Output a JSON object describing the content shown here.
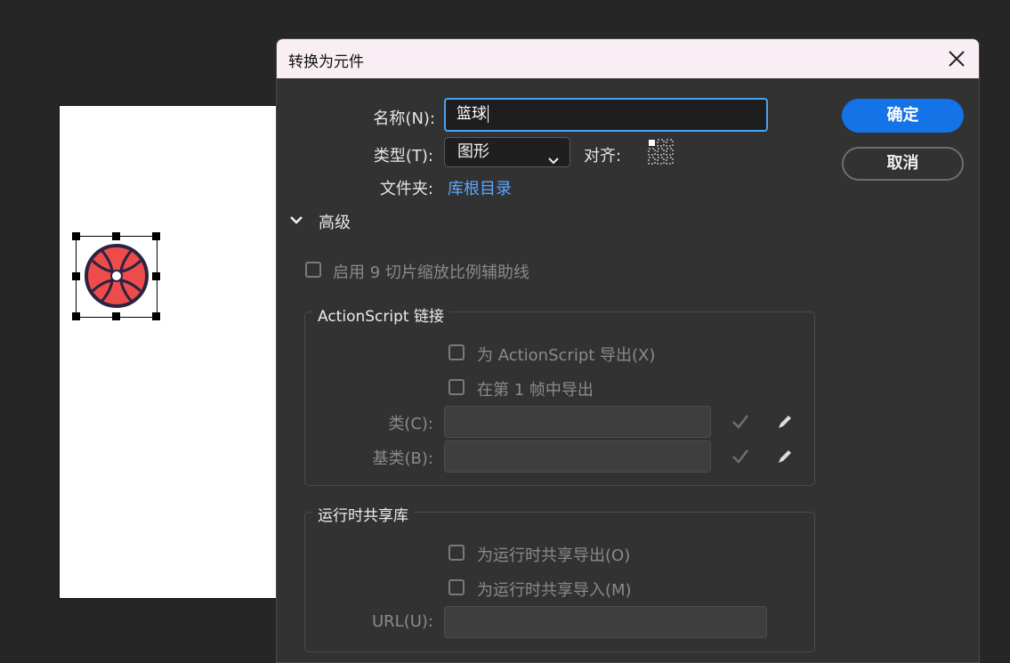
{
  "dialog": {
    "title": "转换为元件",
    "name_label": "名称(N):",
    "name_value": "篮球",
    "type_label": "类型(T):",
    "type_value": "图形",
    "align_label": "对齐:",
    "folder_label": "文件夹:",
    "folder_link": "库根目录",
    "advanced_label": "高级",
    "ok_label": "确定",
    "cancel_label": "取消",
    "nine_slice_label": "启用 9 切片缩放比例辅助线",
    "actionscript": {
      "legend": "ActionScript 链接",
      "export_as_label": "为 ActionScript 导出(X)",
      "export_frame1_label": "在第 1 帧中导出",
      "class_label": "类(C):",
      "base_class_label": "基类(B):"
    },
    "runtime": {
      "legend": "运行时共享库",
      "export_label": "为运行时共享导出(O)",
      "import_label": "为运行时共享导入(M)",
      "url_label": "URL(U):"
    }
  },
  "icons": [
    "close-icon",
    "chevron-down-icon",
    "registration-grid-icon",
    "check-icon",
    "pencil-icon",
    "basketball-icon"
  ],
  "colors": {
    "accent": "#1473e6",
    "link": "#5aa8ff",
    "ball": "#ee4b4b",
    "dialog_bg": "#323232"
  }
}
